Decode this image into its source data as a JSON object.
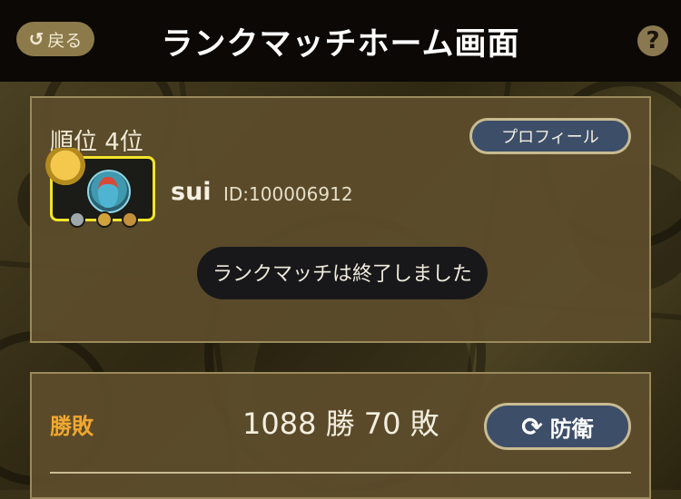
{
  "header": {
    "back_label": "戻る",
    "back_icon": "undo-arrow-icon",
    "title": "ランクマッチホーム画面",
    "help_label": "?"
  },
  "player_card": {
    "rank_text": "順位 4位",
    "profile_button_label": "プロフィール",
    "username": "sui",
    "user_id": "ID:100006912",
    "notice": "ランクマッチは終了しました"
  },
  "record": {
    "label": "勝敗",
    "value": "1088 勝 70 敗",
    "defend_button_label": "防衛",
    "defend_icon": "refresh-icon"
  },
  "colors": {
    "header_bg": "#0b0805",
    "panel_bg": "#5c4c2c",
    "button_bg": "#3d4e68",
    "accent_orange": "#f0a830",
    "frame_yellow": "#f1e42a"
  }
}
